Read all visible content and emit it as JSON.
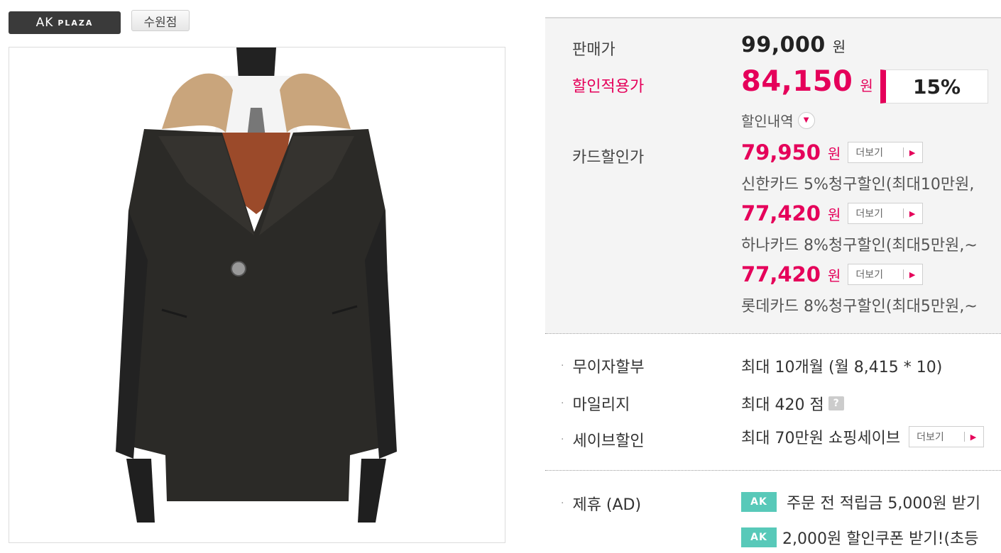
{
  "brand": {
    "logo_main": "AK",
    "logo_sub": "PLAZA",
    "store": "수원점"
  },
  "price": {
    "sale_label": "판매가",
    "sale_value": "99,000",
    "discount_label": "할인적용가",
    "discount_value": "84,150",
    "discount_rate": "15%",
    "discount_detail": "할인내역",
    "currency": "원",
    "card_label": "카드할인가",
    "cards": [
      {
        "price": "79,950",
        "desc": "신한카드 5%청구할인(최대10만원,",
        "more": "더보기"
      },
      {
        "price": "77,420",
        "desc": "하나카드 8%청구할인(최대5만원,~",
        "more": "더보기"
      },
      {
        "price": "77,420",
        "desc": "롯데카드 8%청구할인(최대5만원,~",
        "more": "더보기"
      }
    ]
  },
  "benefits": [
    {
      "label": "무이자할부",
      "value": "최대 10개월 (월 8,415 * 10)"
    },
    {
      "label": "마일리지",
      "value": "최대 420 점",
      "help": "?"
    },
    {
      "label": "세이브할인",
      "value": "최대 70만원 쇼핑세이브",
      "more": "더보기"
    }
  ],
  "partner": {
    "label": "제휴 (AD)",
    "icon_text": "AK",
    "items": [
      {
        "text": "주문 전 적립금 5,000원 받기"
      },
      {
        "text": "2,000원 할인쿠폰 받기!(초등"
      }
    ]
  },
  "colors": {
    "accent": "#e5005a",
    "panel_bg": "#f4f4f4",
    "partner_green": "#58c9b9"
  }
}
